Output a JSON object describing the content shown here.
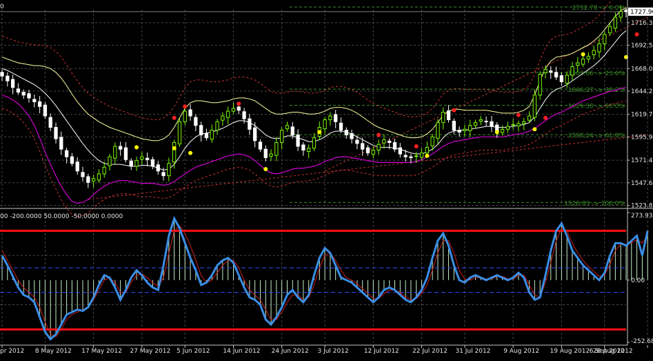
{
  "colors": {
    "background": "#000000",
    "grid": "#4a4a4a",
    "axis": "#c8c8c8",
    "text": "#e6e6e6",
    "bull": "#7cfc00",
    "bear": "#ffffff",
    "bollinger": "#ffffa0",
    "ma": "#ffffff",
    "lower_line": "#d000d0",
    "envelope": "#cc3333",
    "fibo": "#3c8c28",
    "fractal_up": "#ff2020",
    "fractal_down": "#ffff00",
    "cci_line": "#3a8ee6",
    "cci_signal": "#cc2020",
    "cci_hist": "#c8f0c8",
    "level": "#ff1010",
    "level_dash": "#3050ff"
  },
  "header": {
    "price_corner": "0",
    "indicator_label": "00 -200.0000 50.0000 -50.0000 0.0000"
  },
  "chart_data": [
    {
      "type": "candlestick",
      "title": "",
      "ylim": [
        1522,
        1730
      ],
      "y_ticks": [
        "1716.30",
        "1692.50",
        "1668.00",
        "1644.20",
        "1619.70",
        "1595.90",
        "1571.40",
        "1547.60",
        "1523.80"
      ],
      "y_tick_values": [
        1716.3,
        1692.5,
        1668.0,
        1644.2,
        1619.7,
        1595.9,
        1571.4,
        1547.6,
        1523.8
      ],
      "current_price": "1727.90",
      "current_price_value": 1727.9,
      "x_labels": [
        "pr 2012",
        "8 May 2012",
        "17 May 2012",
        "27 May 2012",
        "5 Jun 2012",
        "14 Jun 2012",
        "24 Jun 2012",
        "3 Jul 2012",
        "12 Jul 2012",
        "22 Jul 2012",
        "31 Jul 2012",
        "9 Aug 2012",
        "19 Aug 2012",
        "28 Aug 2012",
        "6 Sep 2012"
      ],
      "x_label_index": [
        0,
        8,
        17,
        26,
        34,
        43,
        52,
        60,
        69,
        78,
        86,
        95,
        104,
        112,
        120
      ],
      "closes": [
        1660,
        1655,
        1648,
        1643,
        1640,
        1637,
        1633,
        1628,
        1618,
        1606,
        1594,
        1583,
        1575,
        1568,
        1560,
        1554,
        1548,
        1552,
        1557,
        1564,
        1575,
        1586,
        1583,
        1572,
        1565,
        1571,
        1575,
        1572,
        1565,
        1560,
        1555,
        1568,
        1590,
        1612,
        1623,
        1618,
        1608,
        1598,
        1595,
        1603,
        1612,
        1618,
        1623,
        1626,
        1624,
        1615,
        1604,
        1592,
        1583,
        1574,
        1578,
        1590,
        1603,
        1608,
        1598,
        1586,
        1582,
        1584,
        1595,
        1606,
        1614,
        1618,
        1612,
        1603,
        1598,
        1594,
        1589,
        1583,
        1579,
        1582,
        1588,
        1593,
        1590,
        1583,
        1578,
        1575,
        1574,
        1576,
        1579,
        1585,
        1596,
        1611,
        1622,
        1614,
        1603,
        1601,
        1604,
        1608,
        1611,
        1614,
        1612,
        1607,
        1602,
        1604,
        1607,
        1609,
        1610,
        1612,
        1618,
        1640,
        1662,
        1667,
        1664,
        1659,
        1654,
        1661,
        1670,
        1674,
        1678,
        1681,
        1687,
        1694,
        1704,
        1712,
        1722,
        1728,
        1727.9
      ],
      "bollinger_upper": [
        1680,
        1678,
        1676,
        1674,
        1673,
        1672,
        1671,
        1671,
        1670,
        1668,
        1664,
        1658,
        1650,
        1641,
        1633,
        1626,
        1620,
        1616,
        1612,
        1609,
        1606,
        1604,
        1602,
        1600,
        1598,
        1596,
        1594,
        1593,
        1592,
        1592,
        1594,
        1598,
        1606,
        1616,
        1626,
        1632,
        1634,
        1634,
        1633,
        1632,
        1632,
        1633,
        1634,
        1636,
        1637,
        1637,
        1636,
        1634,
        1630,
        1626,
        1622,
        1620,
        1620,
        1621,
        1622,
        1622,
        1621,
        1620,
        1620,
        1621,
        1623,
        1626,
        1627,
        1627,
        1626,
        1624,
        1621,
        1617,
        1613,
        1609,
        1606,
        1604,
        1602,
        1600,
        1598,
        1596,
        1595,
        1595,
        1596,
        1599,
        1604,
        1611,
        1619,
        1623,
        1625,
        1625,
        1624,
        1624,
        1624,
        1624,
        1624,
        1623,
        1622,
        1621,
        1621,
        1621,
        1622,
        1624,
        1628,
        1640,
        1655,
        1668,
        1676,
        1680,
        1681,
        1682,
        1684,
        1687,
        1690,
        1693,
        1697,
        1702,
        1709,
        1716,
        1723,
        1729,
        1732
      ],
      "ma_line": [
        1668,
        1666,
        1663,
        1660,
        1657,
        1654,
        1651,
        1647,
        1642,
        1636,
        1629,
        1621,
        1613,
        1605,
        1597,
        1589,
        1582,
        1576,
        1571,
        1568,
        1567,
        1567,
        1567,
        1566,
        1565,
        1565,
        1566,
        1566,
        1565,
        1563,
        1561,
        1562,
        1567,
        1575,
        1584,
        1591,
        1596,
        1599,
        1600,
        1601,
        1603,
        1605,
        1608,
        1611,
        1613,
        1613,
        1611,
        1608,
        1603,
        1598,
        1595,
        1594,
        1595,
        1597,
        1597,
        1595,
        1593,
        1591,
        1591,
        1593,
        1596,
        1600,
        1602,
        1602,
        1601,
        1599,
        1596,
        1593,
        1590,
        1587,
        1585,
        1585,
        1585,
        1584,
        1583,
        1581,
        1579,
        1578,
        1578,
        1580,
        1583,
        1588,
        1595,
        1600,
        1602,
        1603,
        1603,
        1604,
        1605,
        1606,
        1607,
        1607,
        1606,
        1606,
        1606,
        1607,
        1608,
        1609,
        1611,
        1617,
        1626,
        1635,
        1642,
        1646,
        1648,
        1651,
        1655,
        1659,
        1663,
        1667,
        1671,
        1676,
        1682,
        1689,
        1696,
        1703,
        1708
      ],
      "lower_line": [
        1640,
        1638,
        1635,
        1631,
        1625,
        1618,
        1608,
        1595,
        1580,
        1567,
        1555,
        1544,
        1535,
        1528,
        1526,
        1527,
        1530,
        1535,
        1540,
        1544,
        1547,
        1549,
        1550,
        1550,
        1549,
        1548,
        1547,
        1547,
        1547,
        1546,
        1545,
        1546,
        1549,
        1553,
        1557,
        1561,
        1564,
        1566,
        1568,
        1570,
        1572,
        1574,
        1576,
        1577,
        1578,
        1577,
        1575,
        1571,
        1566,
        1561,
        1558,
        1557,
        1558,
        1560,
        1562,
        1563,
        1563,
        1564,
        1565,
        1567,
        1570,
        1572,
        1574,
        1575,
        1575,
        1574,
        1573,
        1572,
        1571,
        1570,
        1569,
        1569,
        1569,
        1569,
        1569,
        1569,
        1569,
        1570,
        1572,
        1575,
        1578,
        1582,
        1586,
        1589,
        1591,
        1592,
        1593,
        1594,
        1595,
        1596,
        1596,
        1596,
        1596,
        1596,
        1597,
        1598,
        1599,
        1600,
        1602,
        1605,
        1609,
        1613,
        1617,
        1620,
        1622,
        1625,
        1628,
        1631,
        1634,
        1636,
        1638,
        1640,
        1642,
        1644,
        1645,
        1647,
        1648
      ],
      "fibo_levels": [
        {
          "label": "1732.78 -> 0.0%",
          "value": 1732.78
        },
        {
          "label": "1663.66 -> 23.6%",
          "value": 1663.66
        },
        {
          "label": "1646.27 -> 38.2%",
          "value": 1646.27
        },
        {
          "label": "1629.30 -> 50.0%",
          "value": 1629.3
        },
        {
          "label": "1598.24 -> 61.8%",
          "value": 1598.24
        },
        {
          "label": "1526.83 -> 100.0%",
          "value": 1526.83
        }
      ],
      "fractals_up": [
        [
          32,
          1616
        ],
        [
          34,
          1628
        ],
        [
          44,
          1631
        ],
        [
          70,
          1598
        ],
        [
          77,
          1586
        ],
        [
          84,
          1624
        ],
        [
          96,
          1619
        ],
        [
          101,
          1616
        ],
        [
          118,
          1704
        ]
      ],
      "fractals_down": [
        [
          25,
          1585
        ],
        [
          32,
          1584
        ],
        [
          35,
          1579
        ],
        [
          49,
          1562
        ],
        [
          59,
          1601
        ],
        [
          79,
          1576
        ],
        [
          92,
          1601
        ],
        [
          99,
          1604
        ],
        [
          108,
          1683
        ],
        [
          116,
          1680
        ]
      ]
    },
    {
      "type": "line",
      "title": "",
      "ylim": [
        -252.6829,
        273.9379
      ],
      "y_ticks": [
        "273.9379",
        "0.00",
        "-252.6829"
      ],
      "y_tick_values": [
        273.9379,
        0.0,
        -252.6829
      ],
      "levels": [
        200,
        -200
      ],
      "dashed_levels": [
        50,
        -50
      ],
      "series": [
        {
          "values": [
            100,
            60,
            15,
            -30,
            -60,
            -70,
            -90,
            -150,
            -210,
            -240,
            -220,
            -180,
            -140,
            -130,
            -120,
            -125,
            -110,
            -70,
            -20,
            20,
            10,
            -30,
            -80,
            -40,
            10,
            40,
            20,
            -10,
            -30,
            -40,
            60,
            180,
            250,
            210,
            150,
            90,
            40,
            -20,
            -10,
            20,
            60,
            80,
            90,
            70,
            20,
            -30,
            -70,
            -80,
            -100,
            -160,
            -180,
            -150,
            -110,
            -60,
            -40,
            -70,
            -90,
            -60,
            20,
            90,
            130,
            110,
            60,
            10,
            0,
            -10,
            -30,
            -50,
            -70,
            -90,
            -70,
            -40,
            -30,
            -40,
            -60,
            -80,
            -90,
            -70,
            -40,
            10,
            90,
            160,
            190,
            140,
            60,
            0,
            -10,
            10,
            20,
            10,
            0,
            10,
            20,
            10,
            0,
            10,
            30,
            10,
            -50,
            -80,
            -70,
            20,
            120,
            200,
            230,
            180,
            120,
            90,
            60,
            40,
            20,
            0,
            30,
            100,
            150,
            150,
            140,
            160,
            180,
            100,
            200
          ]
        },
        {
          "values": [
            120,
            80,
            40,
            0,
            -30,
            -50,
            -70,
            -110,
            -170,
            -220,
            -230,
            -200,
            -160,
            -140,
            -130,
            -120,
            -110,
            -80,
            -40,
            0,
            10,
            -10,
            -50,
            -50,
            -10,
            20,
            25,
            10,
            -10,
            -25,
            10,
            110,
            200,
            220,
            190,
            140,
            80,
            20,
            -10,
            0,
            30,
            60,
            80,
            80,
            50,
            0,
            -40,
            -60,
            -80,
            -120,
            -160,
            -160,
            -130,
            -90,
            -60,
            -60,
            -80,
            -70,
            -20,
            50,
            100,
            110,
            80,
            40,
            10,
            0,
            -15,
            -35,
            -55,
            -75,
            -75,
            -55,
            -40,
            -40,
            -50,
            -70,
            -80,
            -75,
            -55,
            -20,
            40,
            110,
            160,
            160,
            110,
            40,
            5,
            0,
            10,
            10,
            5,
            5,
            15,
            15,
            5,
            5,
            20,
            20,
            -20,
            -60,
            -70,
            -10,
            70,
            160,
            210,
            200,
            150,
            110,
            80,
            55,
            35,
            15,
            20,
            65,
            120,
            145,
            145,
            150,
            165,
            150,
            180
          ]
        }
      ]
    }
  ]
}
